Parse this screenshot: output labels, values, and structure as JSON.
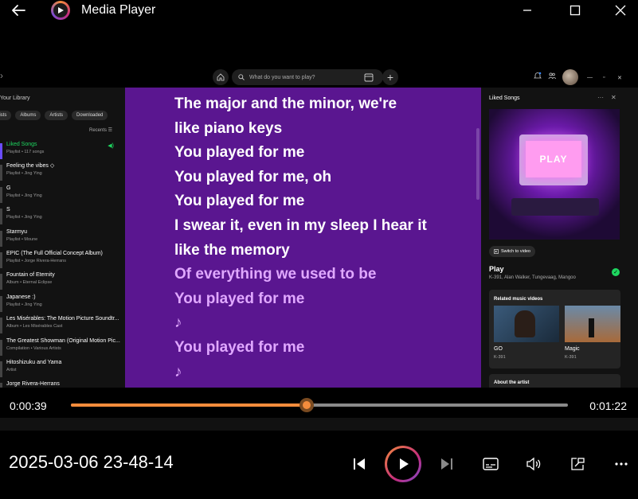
{
  "window": {
    "title": "Media Player",
    "back_icon": "back-arrow-icon",
    "controls": [
      "minimize-icon",
      "maximize-icon",
      "close-icon"
    ]
  },
  "spotify": {
    "search_placeholder": "What do you want to play?",
    "library": {
      "title": "Your Library",
      "chips": [
        "lists",
        "Albums",
        "Artists",
        "Downloaded"
      ],
      "sort_label": "Recents",
      "items": [
        {
          "name": "Liked Songs",
          "sub": "Playlist • 117 songs",
          "active": true
        },
        {
          "name": "Feeling the vibes ◇",
          "sub": "Playlist • Jing Ying"
        },
        {
          "name": "G",
          "sub": "Playlist • Jing Ying"
        },
        {
          "name": "S",
          "sub": "Playlist • Jing Ying"
        },
        {
          "name": "Starmyu",
          "sub": "Playlist • Moune"
        },
        {
          "name": "EPIC (The Full Official Concept Album)",
          "sub": "Playlist • Jorge Rivera-Herrans"
        },
        {
          "name": "Fountain of Eternity",
          "sub": "Album • Eternal Eclipse"
        },
        {
          "name": "Japanese :)",
          "sub": "Playlist • Jing Ying"
        },
        {
          "name": "Les Misérables: The Motion Picture Soundtr...",
          "sub": "Album • Les Misérables Cast"
        },
        {
          "name": "The Greatest Showman (Original Motion Pic...",
          "sub": "Compilation • Various Artists"
        },
        {
          "name": "Hitoshizuku and Yama",
          "sub": "Artist"
        },
        {
          "name": "Jorge Rivera-Herrans",
          "sub": ""
        }
      ]
    },
    "lyrics": [
      {
        "text": "The major and the minor, we're",
        "state": "current"
      },
      {
        "text": "like piano keys",
        "state": "current"
      },
      {
        "text": "You played for me",
        "state": "current"
      },
      {
        "text": "You played for me, oh",
        "state": "current"
      },
      {
        "text": "You played for me",
        "state": "current"
      },
      {
        "text": "I swear it, even in my sleep I hear it",
        "state": "current"
      },
      {
        "text": "like the memory",
        "state": "current"
      },
      {
        "text": "Of everything we used to be",
        "state": "next"
      },
      {
        "text": "You played for me",
        "state": "next"
      },
      {
        "text": "♪",
        "state": "next"
      },
      {
        "text": "You played for me",
        "state": "next"
      },
      {
        "text": "♪",
        "state": "next"
      }
    ],
    "now_playing": {
      "panel_title": "Liked Songs",
      "art_text": "PLAY",
      "switch_video": "Switch to video",
      "track": "Play",
      "artists": "K-391, Alan Walker, Tungevaag, Mangoo",
      "related_title": "Related music videos",
      "videos": [
        {
          "title": "GO",
          "artist": "K-391"
        },
        {
          "title": "Magic",
          "artist": "K-391"
        }
      ],
      "about": "About the artist"
    }
  },
  "player": {
    "elapsed": "0:00:39",
    "total": "0:01:22",
    "progress": 0.475,
    "filename": "2025-03-06 23-48-14",
    "accent": "#f48c3c",
    "buttons": [
      "previous-icon",
      "play-icon",
      "next-icon",
      "captions-icon",
      "volume-icon",
      "mini-player-icon",
      "more-icon"
    ]
  }
}
